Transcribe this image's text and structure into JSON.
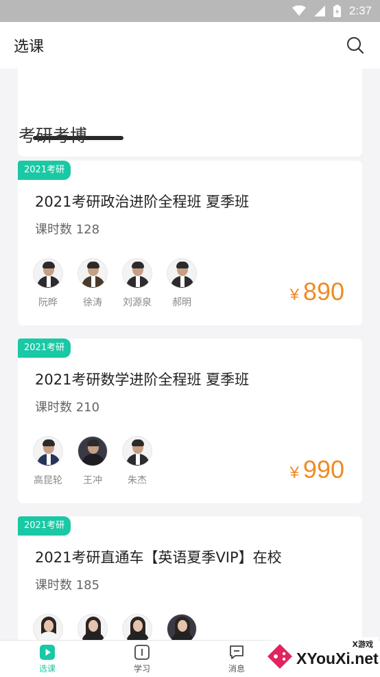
{
  "status_bar": {
    "time": "2:37"
  },
  "header": {
    "title": "选课"
  },
  "section": {
    "title": "考研考博"
  },
  "courses": [
    {
      "tag": "2021考研",
      "title": "2021考研政治进阶全程班 夏季班",
      "hours": "课时数 128",
      "currency": "¥",
      "price": "890",
      "teachers": [
        "阮晔",
        "徐涛",
        "刘源泉",
        "郝明"
      ]
    },
    {
      "tag": "2021考研",
      "title": "2021考研数学进阶全程班 夏季班",
      "hours": "课时数 210",
      "currency": "¥",
      "price": "990",
      "teachers": [
        "高昆轮",
        "王冲",
        "朱杰"
      ]
    },
    {
      "tag": "2021考研",
      "title": "2021考研直通车【英语夏季VIP】在校",
      "hours": "课时数 185",
      "currency": "",
      "price": "",
      "teachers": [
        "",
        "",
        "",
        ""
      ]
    }
  ],
  "tabs": [
    {
      "label": "选课",
      "icon": "play-icon"
    },
    {
      "label": "学习",
      "icon": "study-icon"
    },
    {
      "label": "消息",
      "icon": "message-icon"
    }
  ],
  "watermark": {
    "small": "X游戏",
    "big": "XYouXi.net"
  },
  "colors": {
    "accent": "#19c8a4",
    "price": "#f08a23"
  }
}
